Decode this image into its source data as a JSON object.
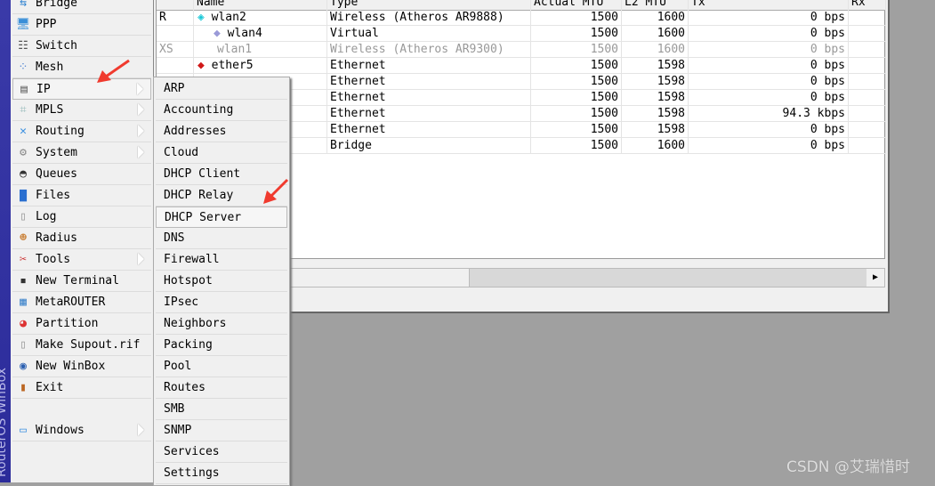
{
  "app": {
    "side_label": "RouterOS WinBox"
  },
  "menu": {
    "items": [
      {
        "label": "Bridge",
        "icon": "bridge-icon",
        "sub": false
      },
      {
        "label": "PPP",
        "icon": "ppp-icon",
        "sub": false
      },
      {
        "label": "Switch",
        "icon": "switch-icon",
        "sub": false
      },
      {
        "label": "Mesh",
        "icon": "mesh-icon",
        "sub": false
      },
      {
        "label": "IP",
        "icon": "ip-icon",
        "sub": true
      },
      {
        "label": "MPLS",
        "icon": "mpls-icon",
        "sub": true
      },
      {
        "label": "Routing",
        "icon": "routing-icon",
        "sub": true
      },
      {
        "label": "System",
        "icon": "system-gear-icon",
        "sub": true
      },
      {
        "label": "Queues",
        "icon": "queues-icon",
        "sub": false
      },
      {
        "label": "Files",
        "icon": "files-icon",
        "sub": false
      },
      {
        "label": "Log",
        "icon": "log-icon",
        "sub": false
      },
      {
        "label": "Radius",
        "icon": "radius-icon",
        "sub": false
      },
      {
        "label": "Tools",
        "icon": "tools-icon",
        "sub": true
      },
      {
        "label": "New Terminal",
        "icon": "terminal-icon",
        "sub": false
      },
      {
        "label": "MetaROUTER",
        "icon": "metarouter-icon",
        "sub": false
      },
      {
        "label": "Partition",
        "icon": "partition-icon",
        "sub": false
      },
      {
        "label": "Make Supout.rif",
        "icon": "supout-icon",
        "sub": false
      },
      {
        "label": "New WinBox",
        "icon": "winbox-icon",
        "sub": false
      },
      {
        "label": "Exit",
        "icon": "exit-door-icon",
        "sub": false
      },
      {
        "label": "Windows",
        "icon": "windows-icon",
        "sub": true
      }
    ]
  },
  "submenu": {
    "items": [
      "ARP",
      "Accounting",
      "Addresses",
      "Cloud",
      "DHCP Client",
      "DHCP Relay",
      "DHCP Server",
      "DNS",
      "Firewall",
      "Hotspot",
      "IPsec",
      "Neighbors",
      "Packing",
      "Pool",
      "Routes",
      "SMB",
      "SNMP",
      "Services",
      "Settings"
    ],
    "highlighted": "DHCP Server"
  },
  "table": {
    "headers": [
      "",
      "Name",
      "Type",
      "Actual MTU",
      "L2 MTU",
      "Tx",
      "Rx"
    ],
    "rows": [
      {
        "flag": "R",
        "name": "wlan2",
        "type": "Wireless (Atheros AR9888)",
        "mtu": "1500",
        "l2mtu": "1600",
        "tx": "0 bps",
        "disabled": false,
        "indent": false,
        "icon": "wireless-icon"
      },
      {
        "flag": "",
        "name": "wlan4",
        "type": "Virtual",
        "mtu": "1500",
        "l2mtu": "1600",
        "tx": "0 bps",
        "disabled": false,
        "indent": true,
        "icon": "virtual-icon"
      },
      {
        "flag": "XS",
        "name": "wlan1",
        "type": "Wireless (Atheros AR9300)",
        "mtu": "1500",
        "l2mtu": "1600",
        "tx": "0 bps",
        "disabled": true,
        "indent": false,
        "icon": ""
      },
      {
        "flag": "",
        "name": "ether5",
        "type": "Ethernet",
        "mtu": "1500",
        "l2mtu": "1598",
        "tx": "0 bps",
        "disabled": false,
        "indent": false,
        "icon": "ethernet-icon"
      },
      {
        "flag": "",
        "name": "",
        "type": "Ethernet",
        "mtu": "1500",
        "l2mtu": "1598",
        "tx": "0 bps",
        "disabled": false,
        "indent": false,
        "icon": ""
      },
      {
        "flag": "",
        "name": "",
        "type": "Ethernet",
        "mtu": "1500",
        "l2mtu": "1598",
        "tx": "0 bps",
        "disabled": false,
        "indent": false,
        "icon": ""
      },
      {
        "flag": "",
        "name": "",
        "type": "Ethernet",
        "mtu": "1500",
        "l2mtu": "1598",
        "tx": "94.3 kbps",
        "disabled": false,
        "indent": false,
        "icon": ""
      },
      {
        "flag": "",
        "name": "",
        "type": "Ethernet",
        "mtu": "1500",
        "l2mtu": "1598",
        "tx": "0 bps",
        "disabled": false,
        "indent": false,
        "icon": ""
      },
      {
        "flag": "",
        "name": "",
        "type": "Bridge",
        "mtu": "1500",
        "l2mtu": "1600",
        "tx": "0 bps",
        "disabled": false,
        "indent": false,
        "icon": ""
      }
    ]
  },
  "watermark": "CSDN @艾瑞惜时",
  "colors": {
    "arrow": "#f03a2e",
    "strip": "#3030a0"
  }
}
